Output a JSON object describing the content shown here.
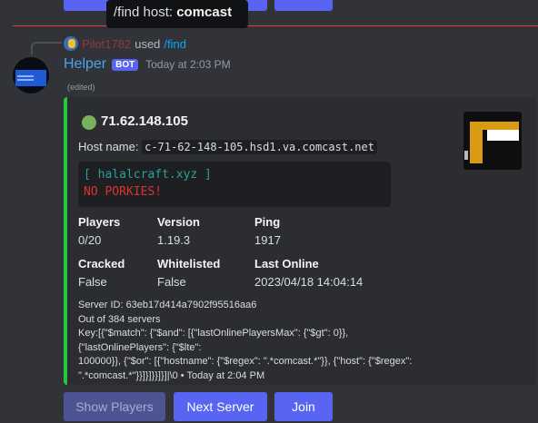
{
  "tooltip": {
    "prefix": "/find host: ",
    "value": "comcast"
  },
  "reply": {
    "username": "Pilot1782",
    "used_text": "used",
    "command": "/find"
  },
  "message": {
    "author": "Helper",
    "badge": "BOT",
    "timestamp": "Today at 2:03 PM",
    "edited": "(edited)"
  },
  "embed": {
    "accent_color": "#22c93a",
    "status_icon": "green-circle-icon",
    "title": "71.62.148.105",
    "host_label": "Host name:",
    "host_value": "c-71-62-148-105.hsd1.va.comcast.net",
    "motd_line1": "[ halalcraft.xyz ]",
    "motd_line2": "NO PORKIES!",
    "fields": [
      {
        "name": "Players",
        "value": "0/20"
      },
      {
        "name": "Version",
        "value": "1.19.3"
      },
      {
        "name": "Ping",
        "value": "1917"
      },
      {
        "name": "Cracked",
        "value": "False"
      },
      {
        "name": "Whitelisted",
        "value": "False"
      },
      {
        "name": "Last Online",
        "value": "2023/04/18 14:04:14"
      }
    ],
    "footer_lines": [
      "Server ID: 63eb17d414a7902f95516aa6",
      "Out of 384 servers",
      "Key:[{\"$match\": {\"$and\": [{\"lastOnlinePlayersMax\": {\"$gt\": 0}}, {\"lastOnlinePlayers\": {\"$lte\":",
      "100000}}, {\"$or\": [{\"hostname\": {\"$regex\": \".*comcast.*\"}}, {\"host\": {\"$regex\":",
      "\".*comcast.*\"}}]}]}}]}]|\\0 • Today at 2:04 PM"
    ]
  },
  "buttons": {
    "show_players": "Show Players",
    "next_server": "Next Server",
    "join": "Join"
  }
}
